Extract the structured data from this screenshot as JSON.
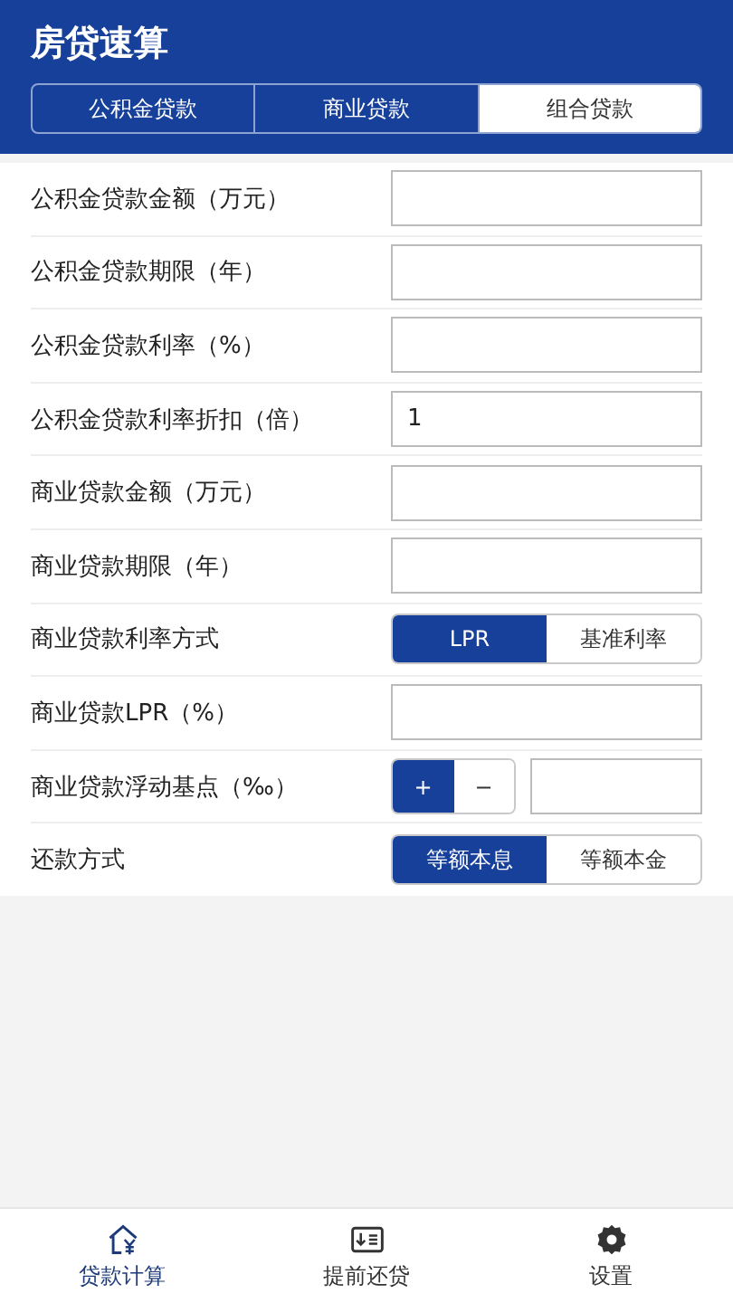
{
  "header": {
    "title": "房贷速算"
  },
  "tabs": [
    {
      "label": "公积金贷款",
      "selected": false
    },
    {
      "label": "商业贷款",
      "selected": false
    },
    {
      "label": "组合贷款",
      "selected": true
    }
  ],
  "rows": [
    {
      "kind": "input",
      "label": "公积金贷款金额（万元）"
    },
    {
      "kind": "input",
      "label": "公积金贷款期限（年）"
    },
    {
      "kind": "input",
      "label": "公积金贷款利率（%）"
    },
    {
      "kind": "input",
      "label": "公积金贷款利率折扣（倍）",
      "value": "1"
    },
    {
      "kind": "input",
      "label": "商业贷款金额（万元）"
    },
    {
      "kind": "input",
      "label": "商业贷款期限（年）"
    },
    {
      "kind": "segment",
      "label": "商业贷款利率方式",
      "options": [
        {
          "label": "LPR",
          "selected": true
        },
        {
          "label": "基准利率",
          "selected": false
        }
      ]
    },
    {
      "kind": "input",
      "label": "商业贷款LPR（%）"
    },
    {
      "kind": "stepper",
      "label": "商业贷款浮动基点（‰）",
      "options": [
        {
          "label": "+",
          "selected": true
        },
        {
          "label": "−",
          "selected": false
        }
      ]
    },
    {
      "kind": "segment",
      "label": "还款方式",
      "options": [
        {
          "label": "等额本息",
          "selected": true
        },
        {
          "label": "等额本金",
          "selected": false
        }
      ]
    }
  ],
  "nav": [
    {
      "label": "贷款计算",
      "selected": true
    },
    {
      "label": "提前还贷",
      "selected": false
    },
    {
      "label": "设置",
      "selected": false
    }
  ]
}
